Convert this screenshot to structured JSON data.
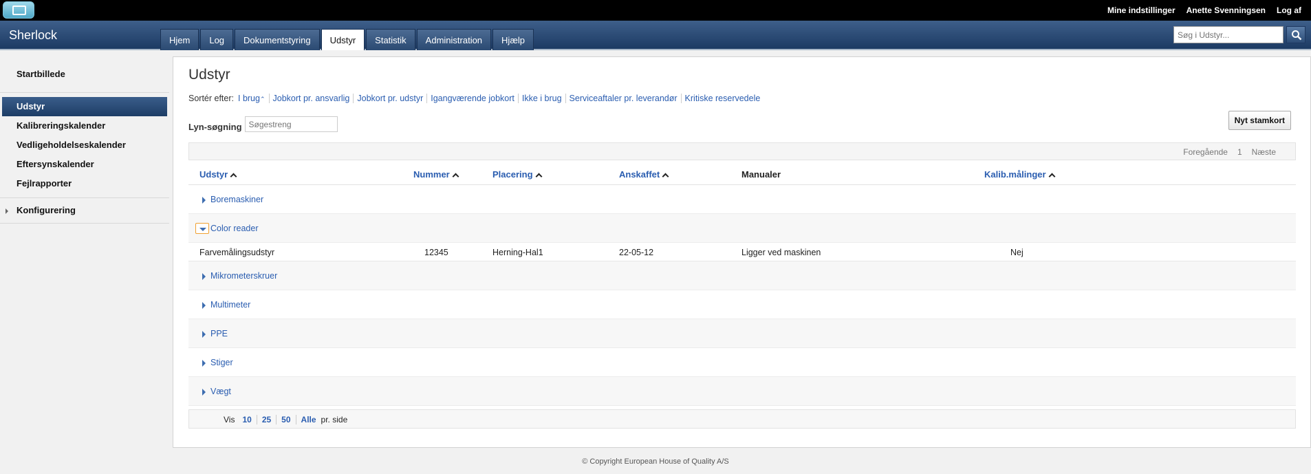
{
  "topbar": {
    "links": [
      "Mine indstillinger",
      "Anette Svenningsen",
      "Log af"
    ]
  },
  "header": {
    "app_title": "Sherlock",
    "tabs": [
      "Hjem",
      "Log",
      "Dokumentstyring",
      "Udstyr",
      "Statistik",
      "Administration",
      "Hjælp"
    ],
    "active_tab": "Udstyr",
    "search_placeholder": "Søg i Udstyr..."
  },
  "sidebar": {
    "items": [
      "Startbillede",
      "Udstyr",
      "Kalibreringskalender",
      "Vedligeholdelseskalender",
      "Eftersynskalender",
      "Fejlrapporter",
      "Konfigurering"
    ],
    "active": "Udstyr"
  },
  "main": {
    "title": "Udstyr",
    "sort_label": "Sortér efter:",
    "sort_options": [
      "I brug",
      "Jobkort pr. ansvarlig",
      "Jobkort pr. udstyr",
      "Igangværende jobkort",
      "Ikke i brug",
      "Serviceaftaler pr. leverandør",
      "Kritiske reservedele"
    ],
    "quick_search_label": "Lyn-søgning",
    "quick_search_placeholder": "Søgestreng",
    "new_button": "Nyt stamkort",
    "pager": {
      "prev": "Foregående",
      "page": "1",
      "next": "Næste"
    },
    "columns": [
      "Udstyr",
      "Nummer",
      "Placering",
      "Anskaffet",
      "Manualer",
      "Kalib.målinger"
    ],
    "groups": [
      "Boremaskiner",
      "Color reader",
      "Mikrometerskruer",
      "Multimeter",
      "PPE",
      "Stiger",
      "Vægt"
    ],
    "expanded_group": "Color reader",
    "rows": [
      {
        "udstyr": "Farvemålingsudstyr",
        "nummer": "12345",
        "placering": "Herning-Hal1",
        "anskaffet": "22-05-12",
        "manualer": "Ligger ved maskinen",
        "kalib": "Nej"
      }
    ],
    "rows_per_page": {
      "prefix": "Vis",
      "options": [
        "10",
        "25",
        "50",
        "Alle"
      ],
      "suffix": "pr. side"
    }
  },
  "footer": {
    "copyright": "© Copyright European House of Quality A/S"
  },
  "colors": {
    "navy": "#1c3a63",
    "link": "#2a5db0",
    "highlight": "#f0a030"
  }
}
